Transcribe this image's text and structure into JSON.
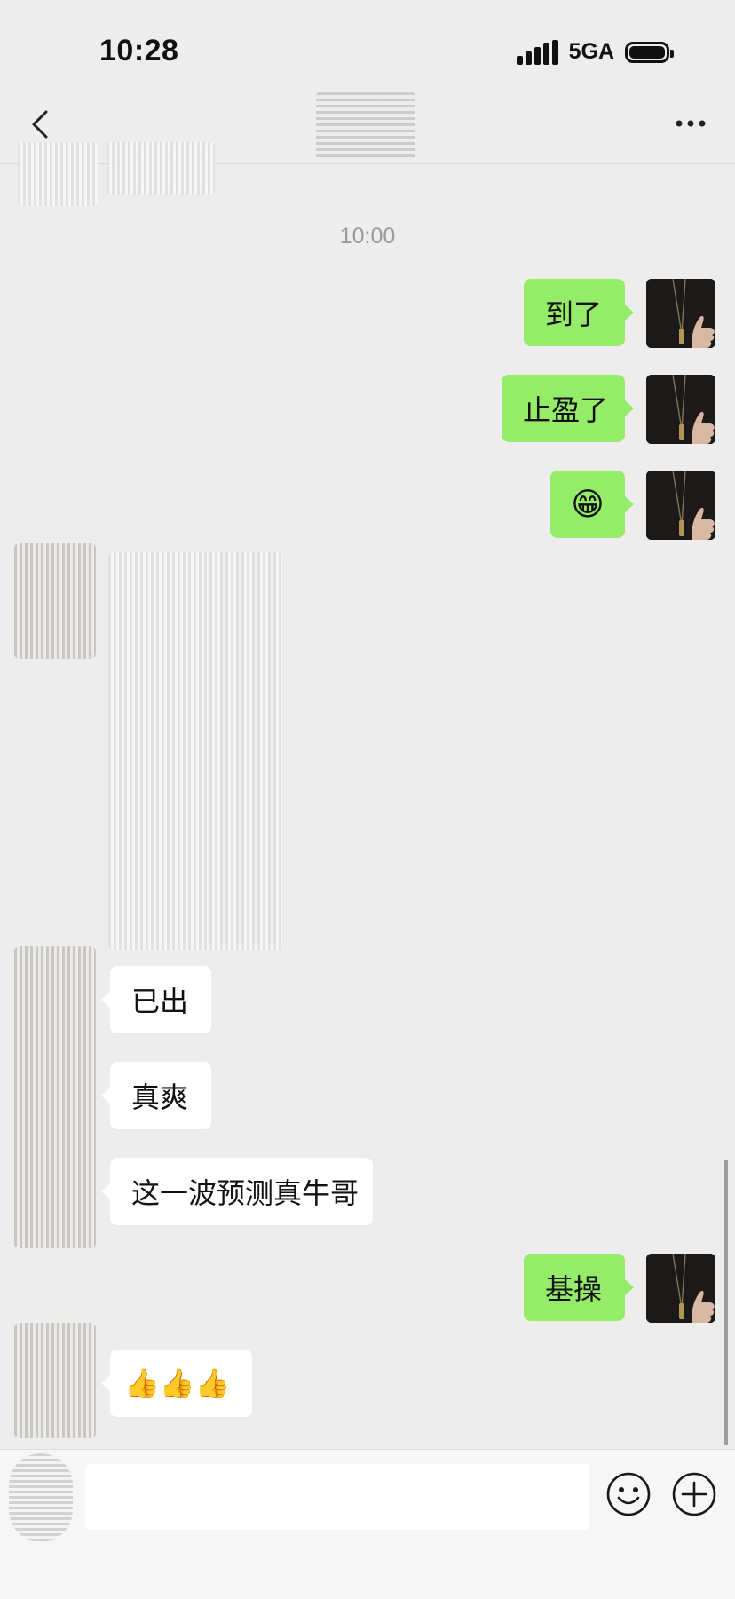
{
  "status_bar": {
    "time": "10:28",
    "network": "5GA"
  },
  "chat": {
    "timestamp": "10:00",
    "messages": [
      {
        "direction": "outgoing",
        "text": "到了"
      },
      {
        "direction": "outgoing",
        "text": "止盈了"
      },
      {
        "direction": "outgoing",
        "text": "😁"
      },
      {
        "direction": "incoming",
        "text": "已出"
      },
      {
        "direction": "incoming",
        "text": "真爽"
      },
      {
        "direction": "incoming",
        "text": "这一波预测真牛哥"
      },
      {
        "direction": "outgoing",
        "text": "基操"
      },
      {
        "direction": "incoming",
        "text": "👍👍👍"
      }
    ]
  },
  "input_bar": {
    "value": "",
    "placeholder": ""
  },
  "colors": {
    "background": "#ededed",
    "outgoing_bubble": "#95ec69",
    "incoming_bubble": "#ffffff",
    "timestamp_text": "#9a9a9a"
  },
  "icons": [
    "back-icon",
    "more-icon",
    "signal-icon",
    "battery-icon",
    "emoji-icon",
    "plus-icon"
  ]
}
